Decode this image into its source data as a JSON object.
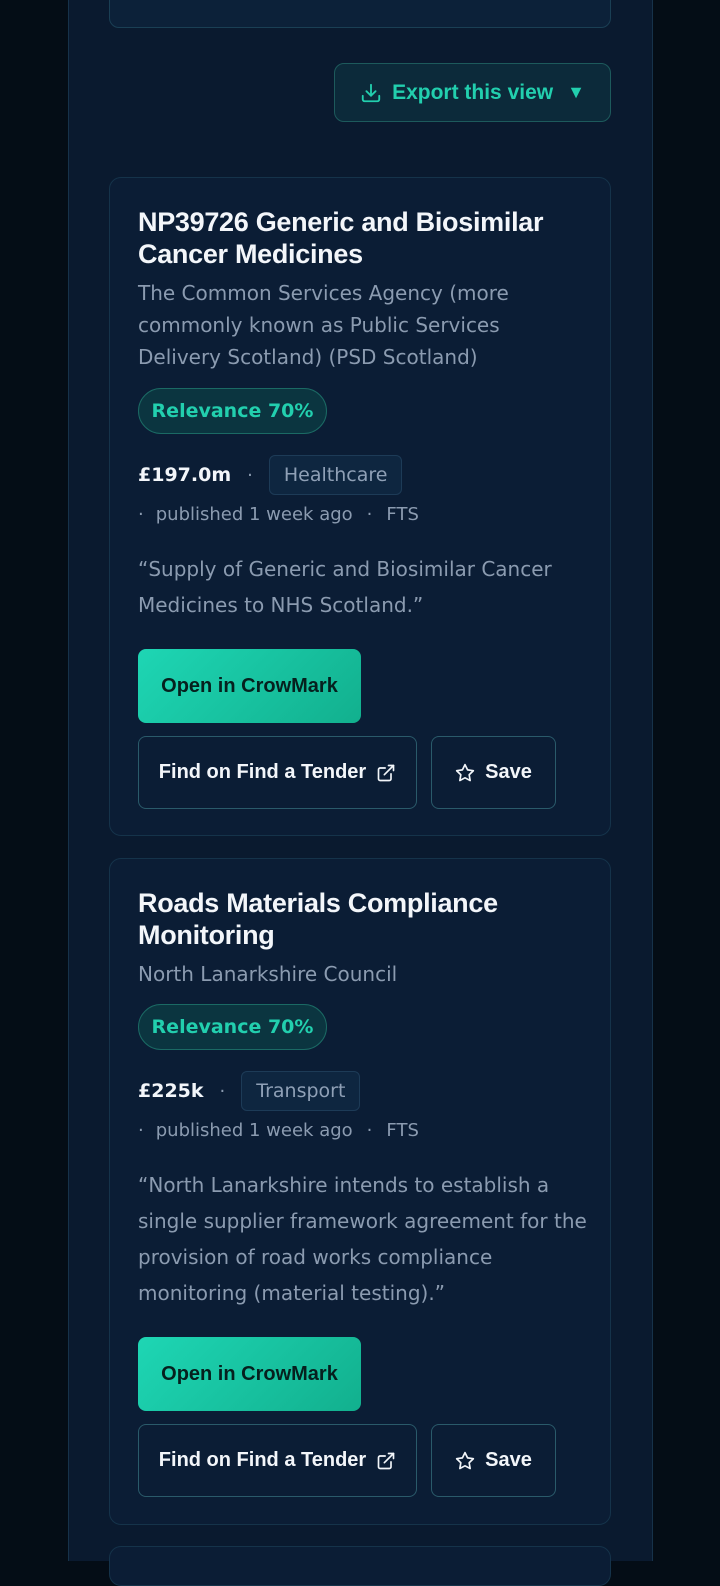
{
  "toolbar": {
    "export_label": "Export this view",
    "export_caret": "▼",
    "export_icon": "download-icon"
  },
  "results": [
    {
      "title": "NP39726 Generic and Biosimilar Cancer Medicines",
      "buyer": "The Common Services Agency (more commonly known as Public Services Delivery Scotland) (PSD Scotland)",
      "relevance": "Relevance 70%",
      "value": "£197.0m",
      "separator": "·",
      "sector": "Healthcare",
      "published": "published 1 week ago",
      "source": "FTS",
      "quote": "“Supply of Generic and Biosimilar Cancer Medicines to NHS Scotland.”",
      "open_label": "Open in CrowMark",
      "find_label": "Find on Find a Tender",
      "save_label": "Save"
    },
    {
      "title": "Roads Materials Compliance Monitoring",
      "buyer": "North Lanarkshire Council",
      "relevance": "Relevance 70%",
      "value": "£225k",
      "separator": "·",
      "sector": "Transport",
      "published": "published 1 week ago",
      "source": "FTS",
      "quote": "“North Lanarkshire intends to establish a single supplier framework agreement for the provision of road works compliance monitoring (material testing).”",
      "open_label": "Open in CrowMark",
      "find_label": "Find on Find a Tender",
      "save_label": "Save"
    }
  ],
  "colors": {
    "accent": "#22cfae",
    "background": "#0a1a2f",
    "card": "#0b1d35"
  }
}
